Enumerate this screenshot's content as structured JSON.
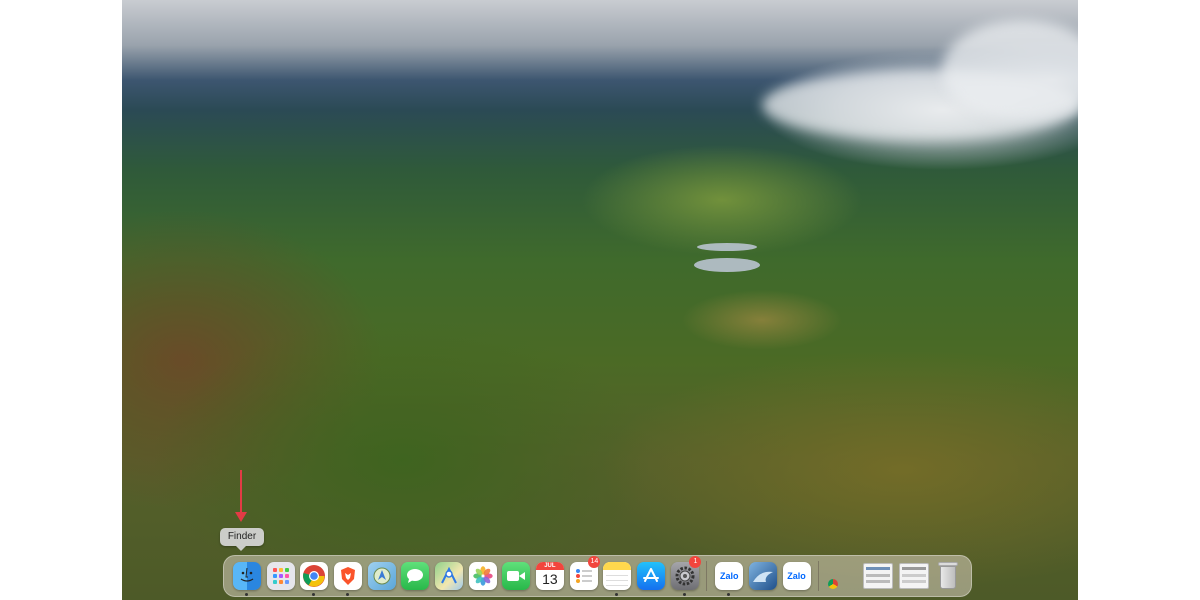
{
  "tooltip": {
    "text": "Finder"
  },
  "dock": {
    "apps": [
      {
        "name": "Finder",
        "icon": "finder-icon",
        "color": "#3aa0ef",
        "running": true
      },
      {
        "name": "Launchpad",
        "icon": "launchpad-icon",
        "color": "#e8e8ee",
        "running": false
      },
      {
        "name": "Google Chrome",
        "icon": "chrome-icon",
        "color": "#ffffff",
        "running": true
      },
      {
        "name": "Brave",
        "icon": "brave-icon",
        "color": "#fb542b",
        "running": true
      },
      {
        "name": "Maps",
        "icon": "compass-icon",
        "color": "#7fb0d8",
        "running": false
      },
      {
        "name": "Messages",
        "icon": "messages-icon",
        "color": "#34c759",
        "running": false
      },
      {
        "name": "Maps",
        "icon": "maps-icon",
        "color": "#62b86b",
        "running": false
      },
      {
        "name": "Photos",
        "icon": "photos-icon",
        "color": "#ffffff",
        "running": false
      },
      {
        "name": "FaceTime",
        "icon": "facetime-icon",
        "color": "#34c759",
        "running": false
      },
      {
        "name": "Calendar",
        "icon": "calendar-icon",
        "month": "JUL",
        "day": "13",
        "running": false
      },
      {
        "name": "Reminders",
        "icon": "reminders-icon",
        "color": "#ffffff",
        "badge": "14",
        "running": false
      },
      {
        "name": "Notes",
        "icon": "notes-icon",
        "color": "#ffd84d",
        "running": true
      },
      {
        "name": "App Store",
        "icon": "app-store-icon",
        "color": "#1f8af5",
        "running": false
      },
      {
        "name": "System Settings",
        "icon": "gear-icon",
        "color": "#8e8e93",
        "badge": "1",
        "running": true
      }
    ],
    "apps2": [
      {
        "name": "Zalo",
        "label": "Zalo",
        "icon": "zalo-icon",
        "color": "#0068ff",
        "running": true
      },
      {
        "name": "Monterey",
        "icon": "wave-icon",
        "color": "#2e6fb0",
        "running": false
      },
      {
        "name": "Zalo",
        "label": "Zalo",
        "icon": "zalo-icon",
        "color": "#0068ff",
        "running": false
      }
    ],
    "minimized": [
      {
        "name": "Chrome window",
        "icon": "window-thumbnail-icon"
      },
      {
        "name": "Chrome window 2",
        "icon": "window-thumbnail-icon"
      },
      {
        "name": "Settings window",
        "icon": "window-thumbnail-icon"
      }
    ],
    "trash": {
      "name": "Trash",
      "icon": "trash-icon"
    }
  }
}
